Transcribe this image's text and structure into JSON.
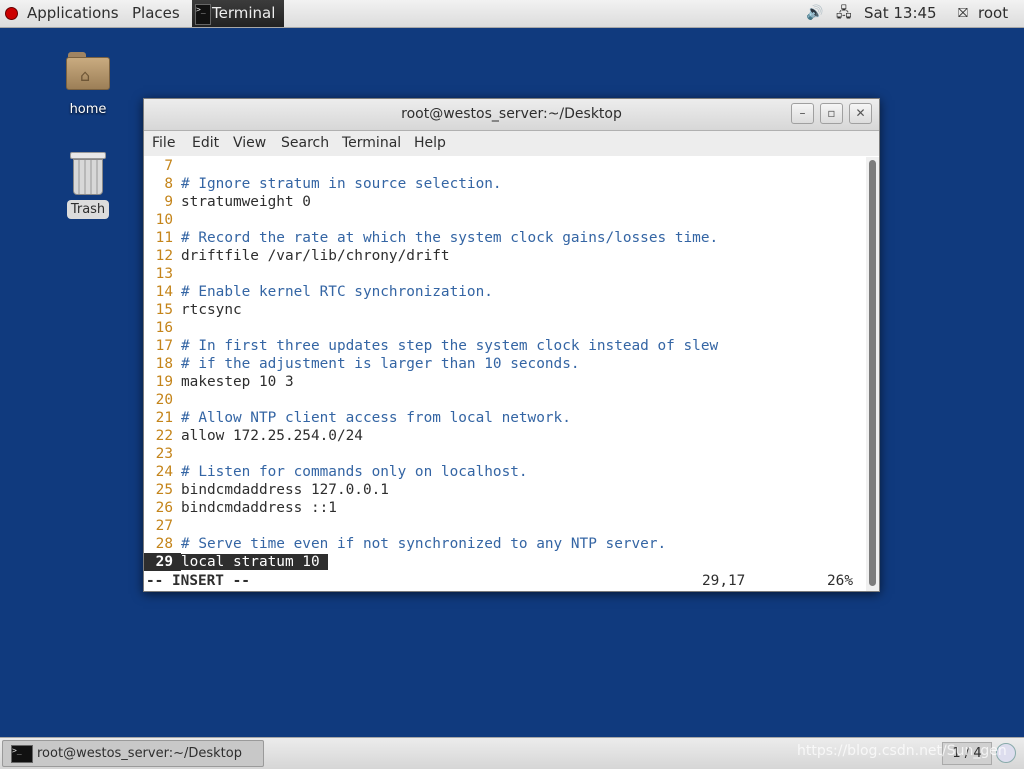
{
  "top_panel": {
    "applications": "Applications",
    "places": "Places",
    "terminal_app": "Terminal",
    "clock": "Sat 13:45",
    "user": "root"
  },
  "desktop": {
    "home_label": "home",
    "trash_label": "Trash"
  },
  "window": {
    "title": "root@westos_server:~/Desktop",
    "menu": [
      "File",
      "Edit",
      "View",
      "Search",
      "Terminal",
      "Help"
    ]
  },
  "editor": {
    "lines": [
      {
        "num": "7",
        "text": ""
      },
      {
        "num": "8",
        "text": "# Ignore stratum in source selection."
      },
      {
        "num": "9",
        "text": "stratumweight 0"
      },
      {
        "num": "10",
        "text": ""
      },
      {
        "num": "11",
        "text": "# Record the rate at which the system clock gains/losses time."
      },
      {
        "num": "12",
        "text": "driftfile /var/lib/chrony/drift"
      },
      {
        "num": "13",
        "text": ""
      },
      {
        "num": "14",
        "text": "# Enable kernel RTC synchronization."
      },
      {
        "num": "15",
        "text": "rtcsync"
      },
      {
        "num": "16",
        "text": ""
      },
      {
        "num": "17",
        "text": "# In first three updates step the system clock instead of slew"
      },
      {
        "num": "18",
        "text": "# if the adjustment is larger than 10 seconds."
      },
      {
        "num": "19",
        "text": "makestep 10 3"
      },
      {
        "num": "20",
        "text": ""
      },
      {
        "num": "21",
        "text": "# Allow NTP client access from local network."
      },
      {
        "num": "22",
        "text": "allow 172.25.254.0/24"
      },
      {
        "num": "23",
        "text": ""
      },
      {
        "num": "24",
        "text": "# Listen for commands only on localhost."
      },
      {
        "num": "25",
        "text": "bindcmdaddress 127.0.0.1"
      },
      {
        "num": "26",
        "text": "bindcmdaddress ::1"
      },
      {
        "num": "27",
        "text": ""
      },
      {
        "num": "28",
        "text": "# Serve time even if not synchronized to any NTP server."
      },
      {
        "num": "29",
        "text": "local stratum 10"
      }
    ],
    "mode": "-- INSERT --",
    "cursor_pos": "29,17",
    "scroll_pct": "26%"
  },
  "bottom_panel": {
    "task_label": "root@westos_server:~/Desktop",
    "workspace": "1 / 4",
    "watermark": "https://blog.csdn.net/Sun_gen"
  }
}
